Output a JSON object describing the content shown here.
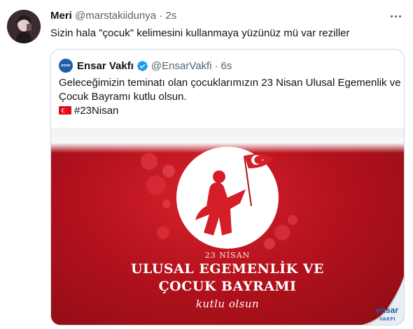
{
  "tweet": {
    "author_name": "Meri",
    "author_handle": "@marstakiidunya",
    "separator": "·",
    "time": "2s",
    "text": "Sizin hala \"çocuk\" kelimesini kullanmaya yüzünüz mü var reziller"
  },
  "quoted": {
    "author_name": "Ensar Vakfı",
    "author_handle": "@EnsarVakfi",
    "separator": "·",
    "time": "6s",
    "text_line1": "Geleceğimizin teminatı olan çocuklarımızın 23 Nisan Ulusal Egemenlik ve",
    "text_line2": "Çocuk Bayramı kutlu olsun.",
    "hashtag": "#23Nisan",
    "media": {
      "date_label": "23 NİSAN",
      "title_line1": "ULUSAL EGEMENLİK VE",
      "title_line2": "ÇOCUK BAYRAMI",
      "script_line": "kutlu olsun",
      "brand_name": "ensar",
      "brand_sub": "VAKFI"
    }
  },
  "colors": {
    "text": "#0f1419",
    "secondary": "#536471",
    "border": "#cfd9de",
    "verified": "#1d9bf0",
    "media_red": "#c8141f",
    "brand_blue": "#1f5ea8"
  },
  "icons": {
    "more": "more-horizontal-icon",
    "verified": "verified-badge-icon",
    "flag": "turkey-flag-icon"
  }
}
